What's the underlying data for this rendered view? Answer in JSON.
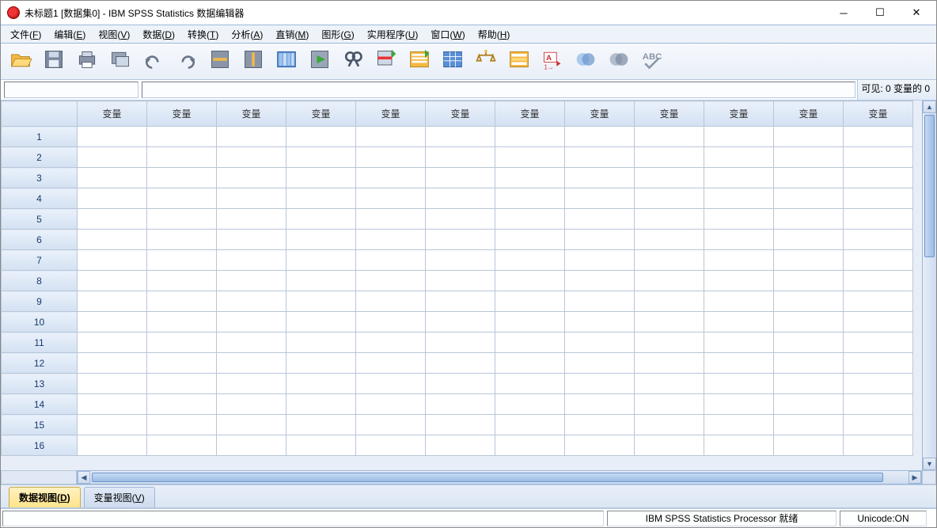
{
  "window": {
    "title": "未标题1 [数据集0] - IBM SPSS Statistics 数据编辑器"
  },
  "menubar": {
    "items": [
      {
        "label": "文件",
        "key": "F"
      },
      {
        "label": "编辑",
        "key": "E"
      },
      {
        "label": "视图",
        "key": "V"
      },
      {
        "label": "数据",
        "key": "D"
      },
      {
        "label": "转换",
        "key": "T"
      },
      {
        "label": "分析",
        "key": "A"
      },
      {
        "label": "直销",
        "key": "M"
      },
      {
        "label": "图形",
        "key": "G"
      },
      {
        "label": "实用程序",
        "key": "U"
      },
      {
        "label": "窗口",
        "key": "W"
      },
      {
        "label": "帮助",
        "key": "H"
      }
    ]
  },
  "toolbar": {
    "icons": [
      "open-file-icon",
      "save-icon",
      "print-icon",
      "recall-dialog-icon",
      "undo-icon",
      "redo-icon",
      "goto-case-icon",
      "goto-variable-icon",
      "variables-icon",
      "run-icon",
      "find-icon",
      "insert-case-icon",
      "insert-variable-icon",
      "split-file-icon",
      "weight-cases-icon",
      "select-cases-icon",
      "value-labels-icon",
      "use-sets-icon",
      "show-all-icon",
      "spell-check-icon"
    ]
  },
  "visible_bar": {
    "text": "可见:  0 变量的 0"
  },
  "grid": {
    "column_header_label": "变量",
    "num_columns": 12,
    "num_rows": 16
  },
  "view_tabs": {
    "data": {
      "label": "数据视图",
      "key": "D"
    },
    "variable": {
      "label": "变量视图",
      "key": "V"
    }
  },
  "statusbar": {
    "processor": "IBM SPSS Statistics Processor 就绪",
    "unicode": "Unicode:ON"
  }
}
